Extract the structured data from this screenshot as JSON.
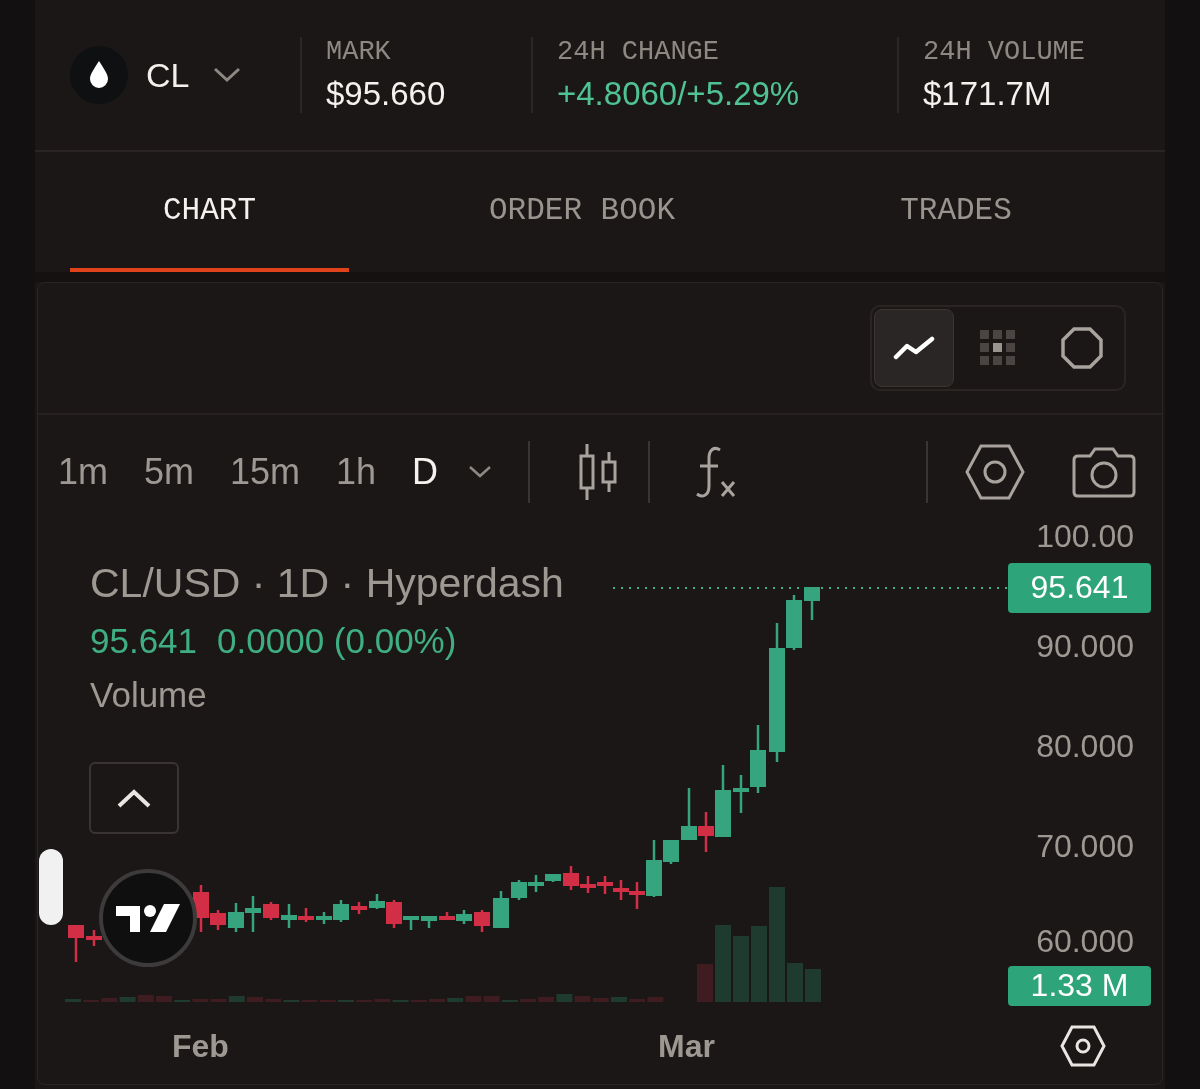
{
  "asset": {
    "symbol": "CL"
  },
  "stats": [
    {
      "label": "MARK",
      "value": "$95.660",
      "positive": false
    },
    {
      "label": "24H CHANGE",
      "value": "+4.8060/+5.29%",
      "positive": true
    },
    {
      "label": "24H VOLUME",
      "value": "$171.7M",
      "positive": false
    }
  ],
  "tabs": [
    {
      "label": "CHART",
      "selected": true
    },
    {
      "label": "ORDER BOOK",
      "selected": false
    },
    {
      "label": "TRADES",
      "selected": false
    }
  ],
  "view_modes": [
    {
      "kind": "line",
      "selected": true
    },
    {
      "kind": "grid",
      "selected": false
    },
    {
      "kind": "octagon",
      "selected": false
    }
  ],
  "timeframes": [
    {
      "label": "1m",
      "selected": false
    },
    {
      "label": "5m",
      "selected": false
    },
    {
      "label": "15m",
      "selected": false
    },
    {
      "label": "1h",
      "selected": false
    },
    {
      "label": "D",
      "selected": true
    }
  ],
  "chart": {
    "legend_title": "CL/USD · 1D · Hyperdash",
    "legend_price": "95.641",
    "legend_change": "0.0000 (0.00%)",
    "volume_label": "Volume",
    "price_ticks": [
      "100.00",
      "90.000",
      "80.000",
      "70.000",
      "60.000"
    ],
    "last_price": "95.641",
    "last_volume": "1.33 M",
    "time_labels": [
      "Feb",
      "Mar"
    ]
  }
}
